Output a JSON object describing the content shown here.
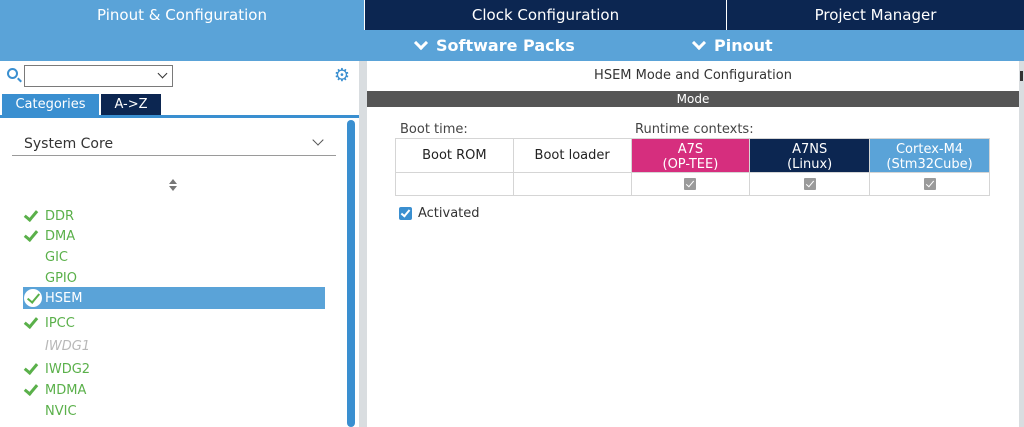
{
  "tabs": [
    {
      "label": "Pinout & Configuration"
    },
    {
      "label": "Clock Configuration"
    },
    {
      "label": "Project Manager"
    }
  ],
  "subbar": {
    "software_packs": "Software Packs",
    "pinout": "Pinout"
  },
  "left": {
    "search_value": "",
    "category_tabs": [
      {
        "label": "Categories"
      },
      {
        "label": "A->Z"
      }
    ],
    "group": "System Core",
    "items": [
      {
        "label": "DDR",
        "state": "checked"
      },
      {
        "label": "DMA",
        "state": "checked"
      },
      {
        "label": "GIC",
        "state": "none"
      },
      {
        "label": "GPIO",
        "state": "none"
      },
      {
        "label": "HSEM",
        "state": "selected"
      },
      {
        "label": "IPCC",
        "state": "checked"
      },
      {
        "label": "IWDG1",
        "state": "disabled"
      },
      {
        "label": "IWDG2",
        "state": "checked"
      },
      {
        "label": "MDMA",
        "state": "checked"
      },
      {
        "label": "NVIC",
        "state": "none"
      }
    ]
  },
  "right": {
    "title": "HSEM Mode and Configuration",
    "mode": "Mode",
    "boot_time_label": "Boot time:",
    "runtime_label": "Runtime contexts:",
    "columns": [
      {
        "line1": "Boot ROM",
        "line2": ""
      },
      {
        "line1": "Boot loader",
        "line2": ""
      },
      {
        "line1": "A7S",
        "line2": "(OP-TEE)"
      },
      {
        "line1": "A7NS",
        "line2": "(Linux)"
      },
      {
        "line1": "Cortex-M4",
        "line2": "(Stm32Cube)"
      }
    ],
    "activated_label": "Activated"
  },
  "colors": {
    "accent": "#5aa3d8",
    "navy": "#0c2651",
    "a7s": "#d62e7e",
    "check_green": "#5ab04a"
  }
}
